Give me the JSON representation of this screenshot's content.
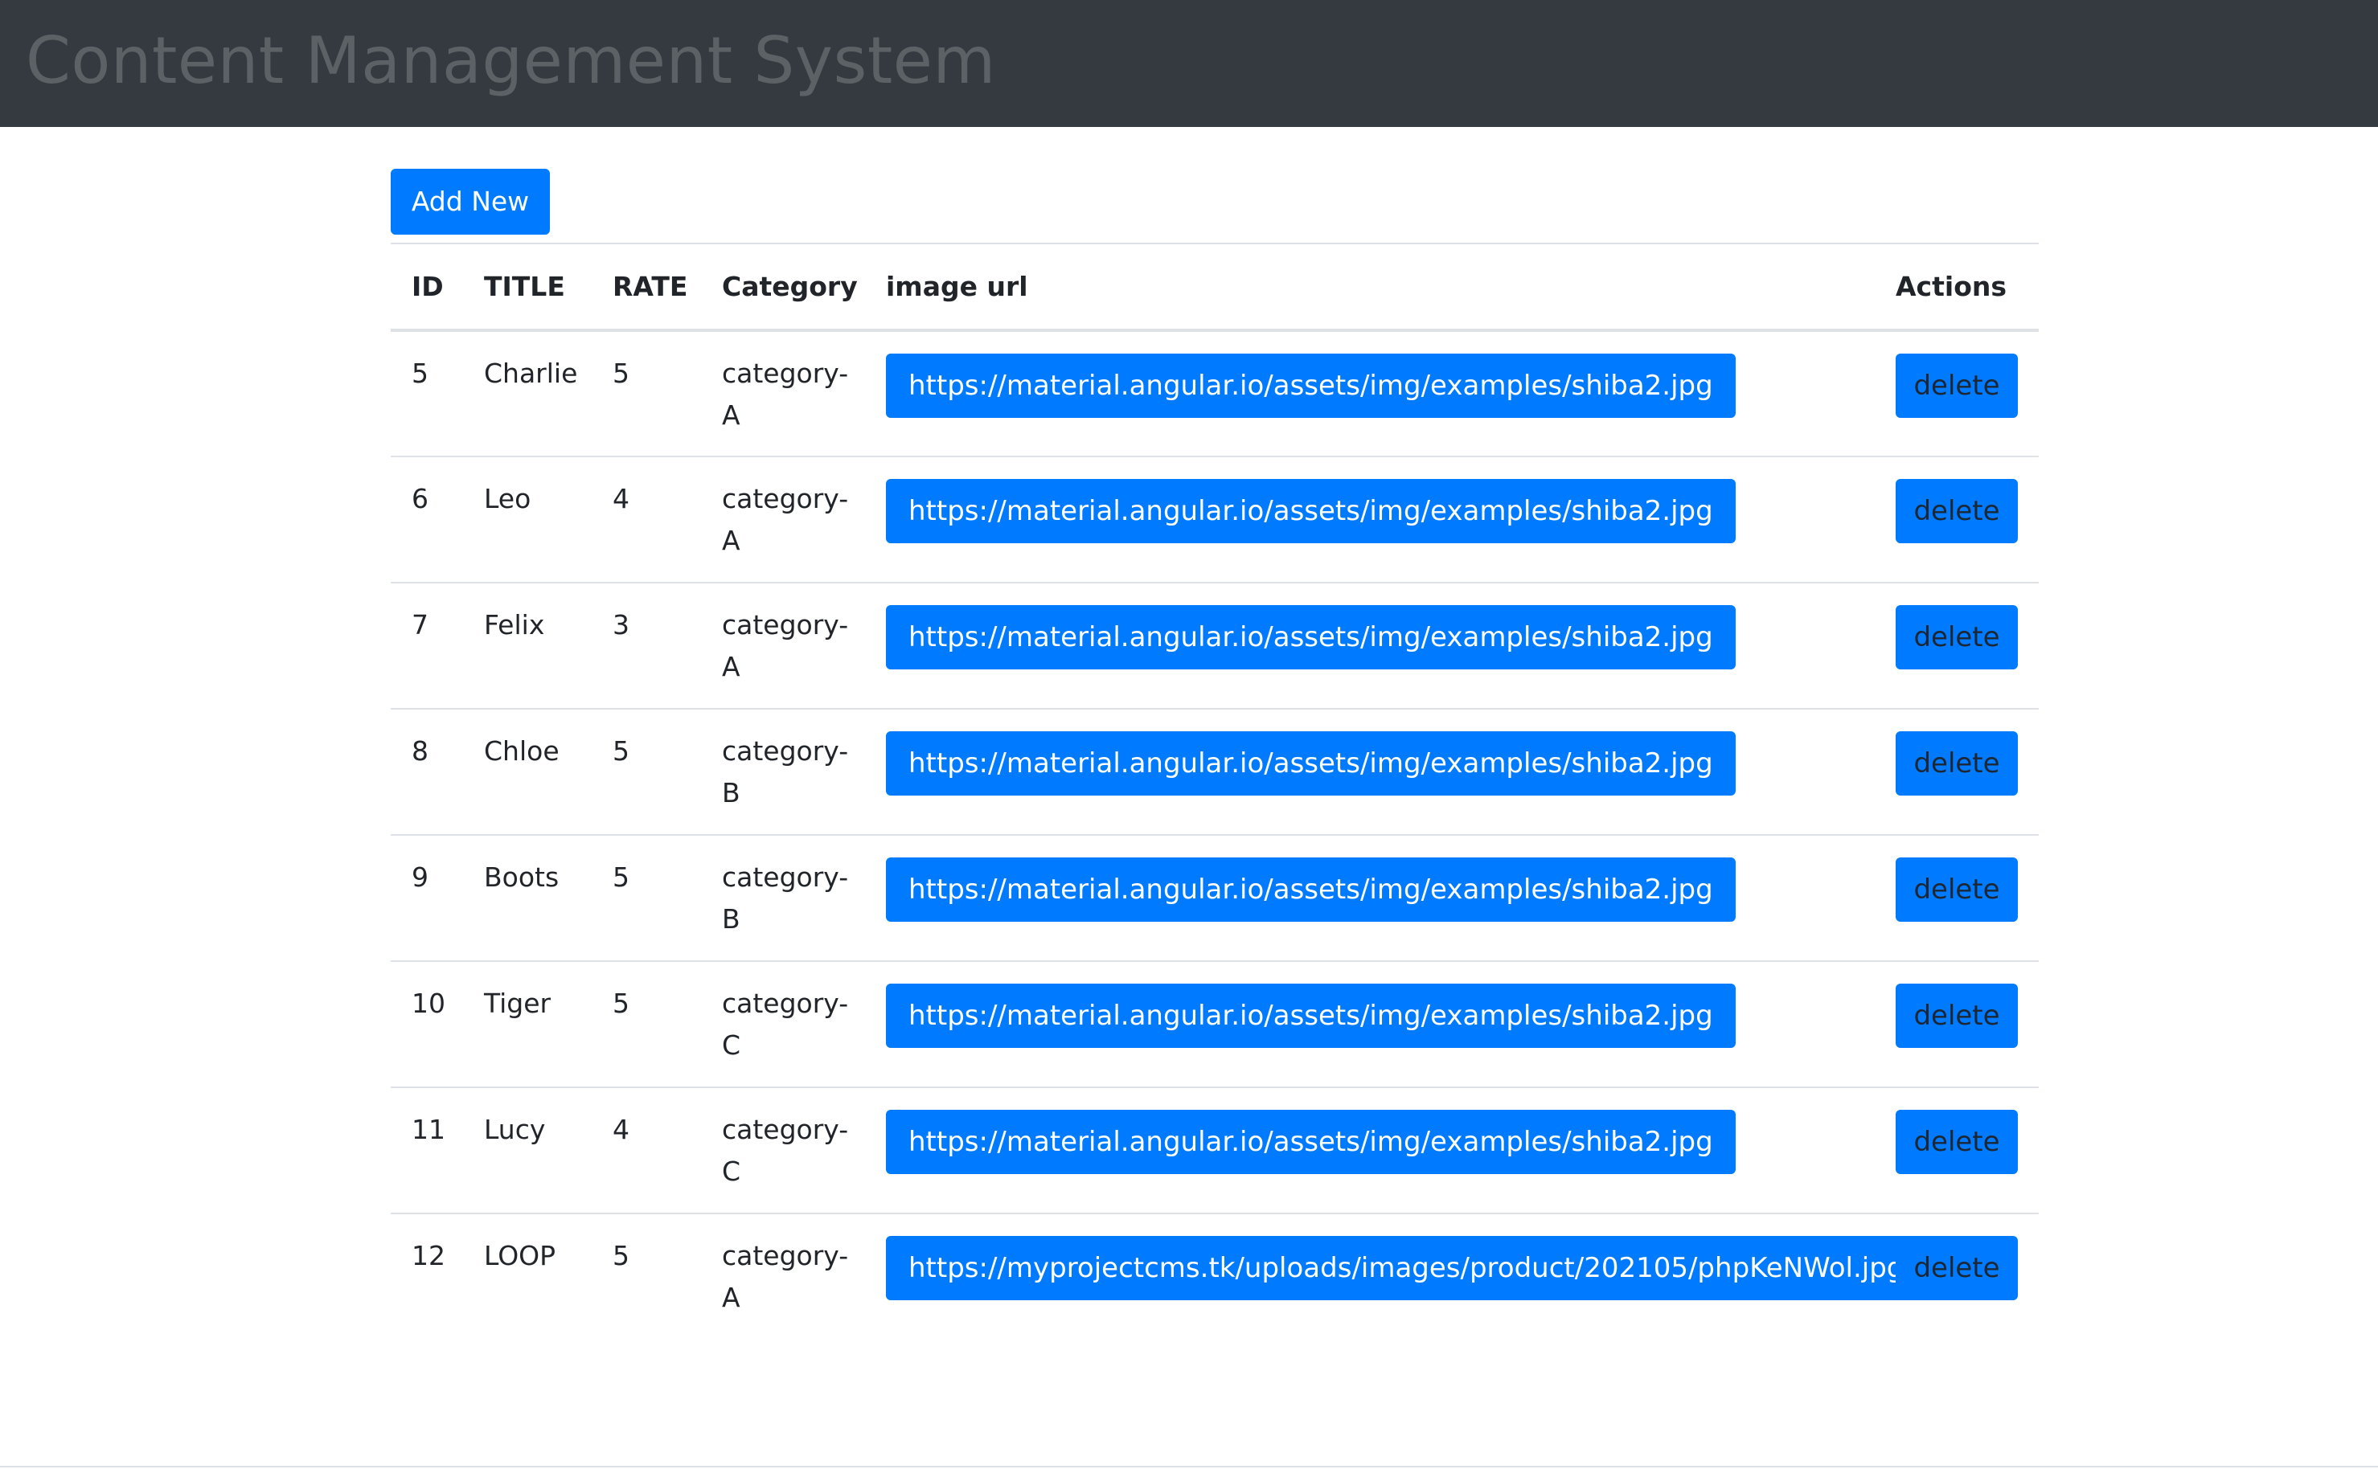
{
  "navbar": {
    "brand": "Content Management System"
  },
  "toolbar": {
    "add_new_label": "Add New"
  },
  "table": {
    "headers": {
      "id": "ID",
      "title": "TITLE",
      "rate": "RATE",
      "category": "Category",
      "image_url": "image url",
      "actions": "Actions"
    },
    "rows": [
      {
        "id": "5",
        "title": "Charlie",
        "rate": "5",
        "category": "category-A",
        "image_url": "https://material.angular.io/assets/img/examples/shiba2.jpg",
        "action": "delete"
      },
      {
        "id": "6",
        "title": "Leo",
        "rate": "4",
        "category": "category-A",
        "image_url": "https://material.angular.io/assets/img/examples/shiba2.jpg",
        "action": "delete"
      },
      {
        "id": "7",
        "title": "Felix",
        "rate": "3",
        "category": "category-A",
        "image_url": "https://material.angular.io/assets/img/examples/shiba2.jpg",
        "action": "delete"
      },
      {
        "id": "8",
        "title": "Chloe",
        "rate": "5",
        "category": "category-B",
        "image_url": "https://material.angular.io/assets/img/examples/shiba2.jpg",
        "action": "delete"
      },
      {
        "id": "9",
        "title": "Boots",
        "rate": "5",
        "category": "category-B",
        "image_url": "https://material.angular.io/assets/img/examples/shiba2.jpg",
        "action": "delete"
      },
      {
        "id": "10",
        "title": "Tiger",
        "rate": "5",
        "category": "category-C",
        "image_url": "https://material.angular.io/assets/img/examples/shiba2.jpg",
        "action": "delete"
      },
      {
        "id": "11",
        "title": "Lucy",
        "rate": "4",
        "category": "category-C",
        "image_url": "https://material.angular.io/assets/img/examples/shiba2.jpg",
        "action": "delete"
      },
      {
        "id": "12",
        "title": "LOOP",
        "rate": "5",
        "category": "category-A",
        "image_url": "https://myprojectcms.tk/uploads/images/product/202105/phpKeNWol.jpg",
        "action": "delete"
      }
    ]
  },
  "colors": {
    "primary": "#007bff",
    "navbar_bg": "#343a40",
    "brand_text": "#5c6166",
    "border": "#dee2e6"
  }
}
